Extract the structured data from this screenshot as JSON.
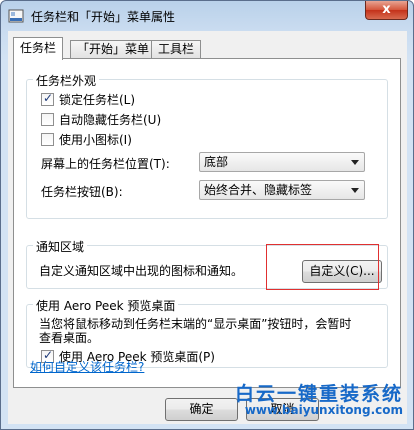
{
  "window": {
    "title": "任务栏和「开始」菜单属性",
    "close_label": "x"
  },
  "tabs": [
    {
      "label": "任务栏",
      "active": true
    },
    {
      "label": "「开始」菜单",
      "active": false
    },
    {
      "label": "工具栏",
      "active": false
    }
  ],
  "appearance": {
    "legend": "任务栏外观",
    "lock_label": "锁定任务栏(L)",
    "lock_checked": true,
    "autohide_label": "自动隐藏任务栏(U)",
    "autohide_checked": false,
    "small_icons_label": "使用小图标(I)",
    "small_icons_checked": false,
    "position_label": "屏幕上的任务栏位置(T):",
    "position_value": "底部",
    "buttons_label": "任务栏按钮(B):",
    "buttons_value": "始终合并、隐藏标签"
  },
  "notification": {
    "legend": "通知区域",
    "description": "自定义通知区域中出现的图标和通知。",
    "customize_label": "自定义(C)..."
  },
  "aero_peek": {
    "legend": "使用 Aero Peek 预览桌面",
    "description_line1": "当您将鼠标移动到任务栏末端的“显示桌面”按钮时，会暂时",
    "description_line2": "查看桌面。",
    "checkbox_label": "使用 Aero Peek 预览桌面(P)",
    "checked": true
  },
  "help_link": "如何自定义该任务栏?",
  "footer": {
    "ok_label": "确定",
    "cancel_label": "取消"
  },
  "watermark": {
    "title": "白云一键重装系统",
    "url": "www.baiyunxitong.com"
  },
  "colors": {
    "link": "#0066cc",
    "highlight_box": "#e03030",
    "watermark": "#1769c8"
  }
}
